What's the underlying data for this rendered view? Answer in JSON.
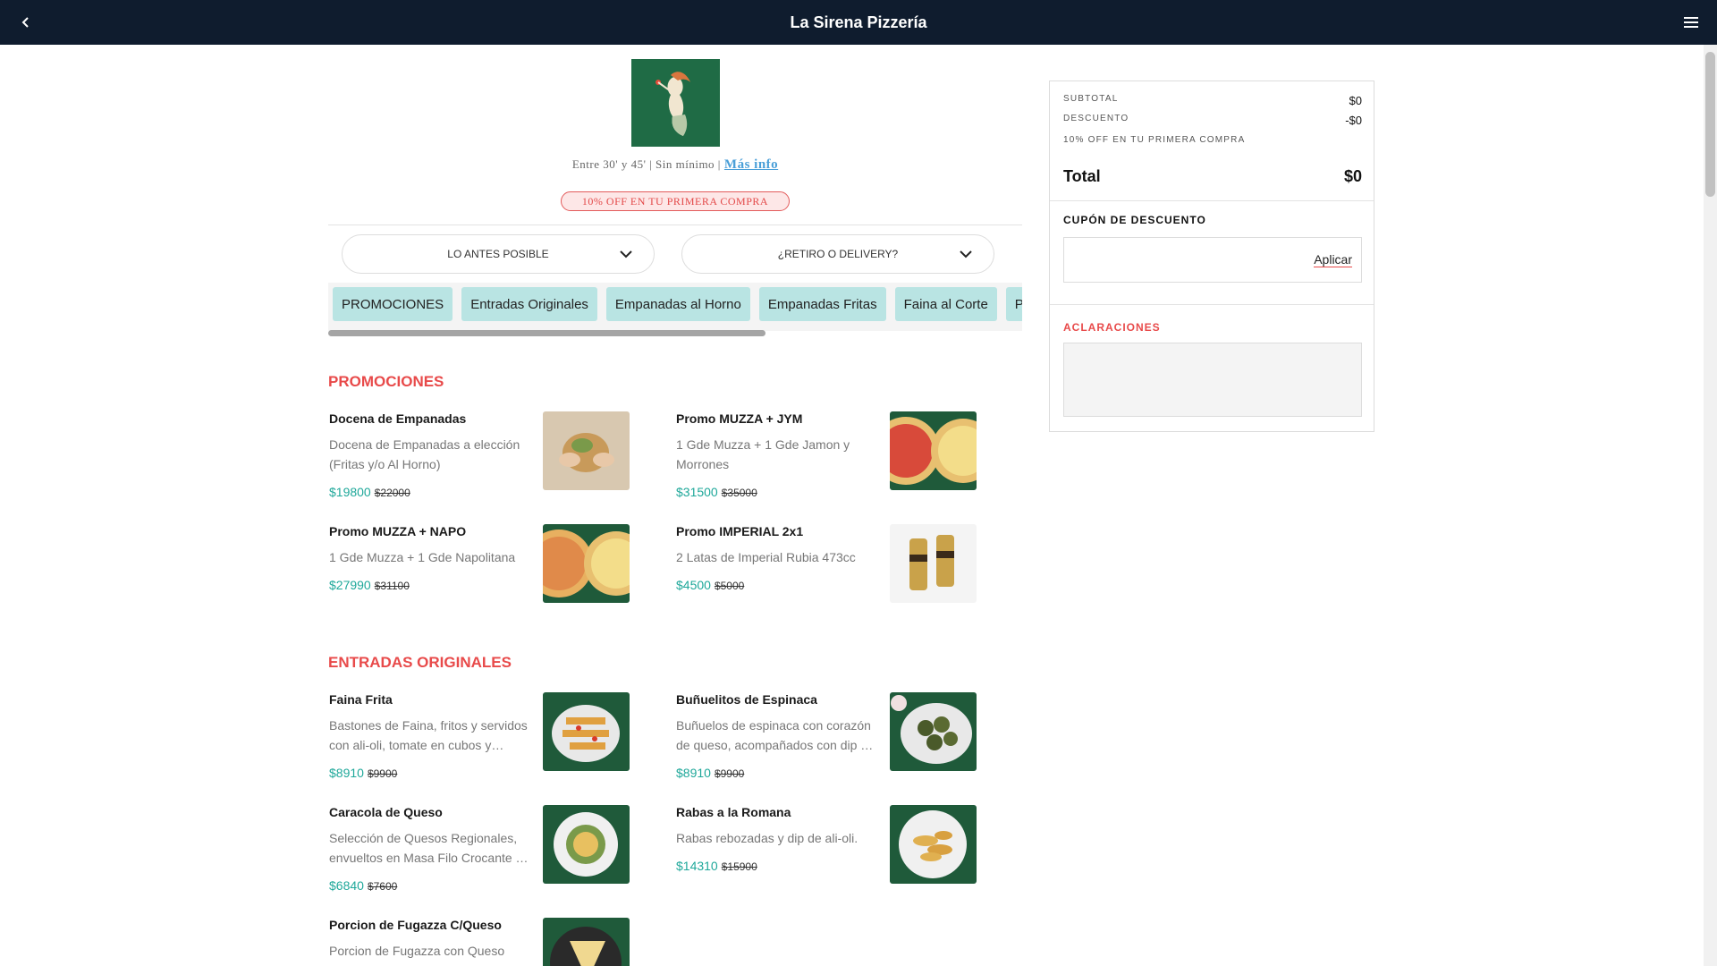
{
  "header": {
    "title": "La Sirena Pizzería",
    "back_icon": "chevron-left-icon",
    "menu_icon": "hamburger-menu-icon"
  },
  "store": {
    "logo_icon": "mermaid-logo",
    "meta_text": "Entre 30' y 45' | Sin mínimo |",
    "more_info": "Más info",
    "promo_badge": "10% OFF EN TU PRIMERA COMPRA"
  },
  "filters": {
    "time_select": "LO ANTES POSIBLE",
    "delivery_select": "¿RETIRO O DELIVERY?"
  },
  "categories": [
    "PROMOCIONES",
    "Entradas Originales",
    "Empanadas al Horno",
    "Empanadas Fritas",
    "Faina al Corte",
    "Pizzas"
  ],
  "sections": [
    {
      "title": "PROMOCIONES",
      "items": [
        {
          "name": "Docena de Empanadas",
          "desc": "Docena de Empanadas a elección (Fritas y/o Al Horno)",
          "price": "$19800",
          "old": "$22000"
        },
        {
          "name": "Promo MUZZA + JYM",
          "desc": "1 Gde Muzza + 1 Gde Jamon y Morrones",
          "price": "$31500",
          "old": "$35000"
        },
        {
          "name": "Promo MUZZA + NAPO",
          "desc": "1 Gde Muzza + 1 Gde Napolitana",
          "price": "$27990",
          "old": "$31100"
        },
        {
          "name": "Promo IMPERIAL 2x1",
          "desc": "2 Latas de Imperial Rubia 473cc",
          "price": "$4500",
          "old": "$5000"
        }
      ]
    },
    {
      "title": "ENTRADAS ORIGINALES",
      "items": [
        {
          "name": "Faina Frita",
          "desc": "Bastones de Faina, fritos y servidos con ali-oli, tomate en cubos y…",
          "price": "$8910",
          "old": "$9900"
        },
        {
          "name": "Buñuelitos de Espinaca",
          "desc": "Buñuelos de espinaca con corazón de queso, acompañados con dip …",
          "price": "$8910",
          "old": "$9900"
        },
        {
          "name": "Caracola de Queso",
          "desc": "Selección de Quesos Regionales, envueltos en Masa Filo Crocante …",
          "price": "$6840",
          "old": "$7600"
        },
        {
          "name": "Rabas a la Romana",
          "desc": "Rabas rebozadas y dip de ali-oli.",
          "price": "$14310",
          "old": "$15900"
        },
        {
          "name": "Porcion de Fugazza C/Queso",
          "desc": "Porcion de Fugazza con Queso",
          "price": "",
          "old": ""
        }
      ]
    }
  ],
  "cart": {
    "subtotal_label": "SUBTOTAL",
    "subtotal": "$0",
    "discount_label": "DESCUENTO",
    "discount": "-$0",
    "discount_note": "10% OFF EN TU PRIMERA COMPRA",
    "total_label": "Total",
    "total": "$0",
    "coupon_label": "CUPÓN DE DESCUENTO",
    "coupon_value": "",
    "apply_label": "Aplicar",
    "notes_label": "ACLARACIONES"
  }
}
